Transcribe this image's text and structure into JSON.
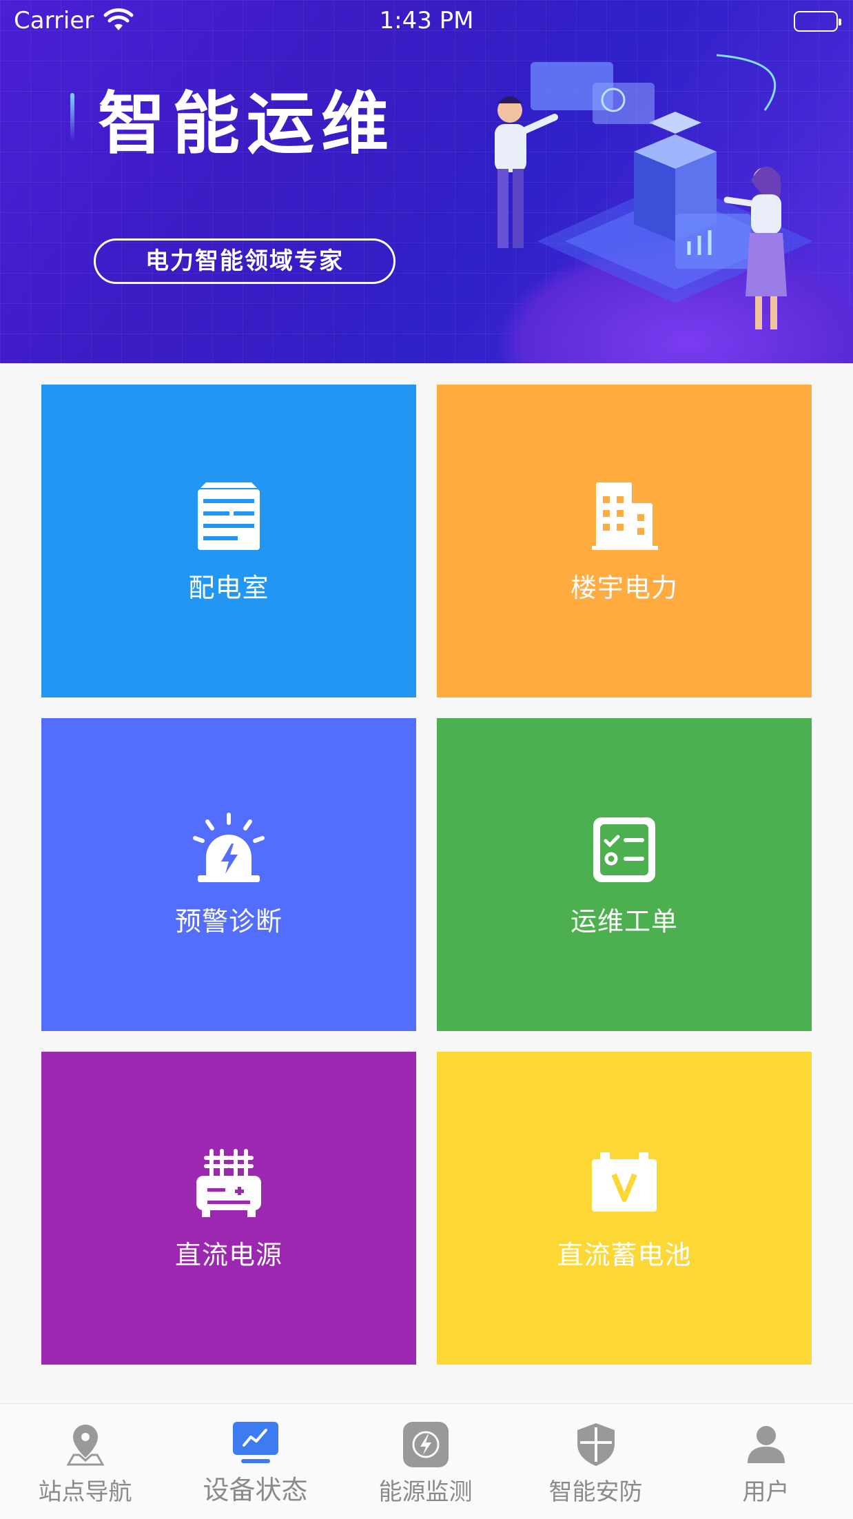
{
  "status_bar": {
    "carrier": "Carrier",
    "time": "1:43 PM"
  },
  "banner": {
    "title": "智能运维",
    "subtitle": "电力智能领域专家"
  },
  "tiles": [
    {
      "label": "配电室",
      "color": "#2196f3",
      "icon": "server-rack-icon"
    },
    {
      "label": "楼宇电力",
      "color": "#ffab40",
      "icon": "building-icon"
    },
    {
      "label": "预警诊断",
      "color": "#536dfe",
      "icon": "alarm-light-icon"
    },
    {
      "label": "运维工单",
      "color": "#4caf50",
      "icon": "checklist-icon"
    },
    {
      "label": "直流电源",
      "color": "#9c27b0",
      "icon": "power-supply-icon"
    },
    {
      "label": "直流蓄电池",
      "color": "#fdd835",
      "icon": "battery-v-icon"
    }
  ],
  "tabbar": {
    "items": [
      {
        "label": "站点导航",
        "icon": "map-pin-icon"
      },
      {
        "label": "设备状态",
        "icon": "monitor-chart-icon",
        "active": true
      },
      {
        "label": "能源监测",
        "icon": "energy-icon"
      },
      {
        "label": "智能安防",
        "icon": "shield-icon"
      },
      {
        "label": "用户",
        "icon": "user-icon"
      }
    ]
  },
  "colors": {
    "banner": "#3b1bc4",
    "active_tab_icon": "#3d7bf0",
    "tab_inactive": "#8a8a8a"
  }
}
